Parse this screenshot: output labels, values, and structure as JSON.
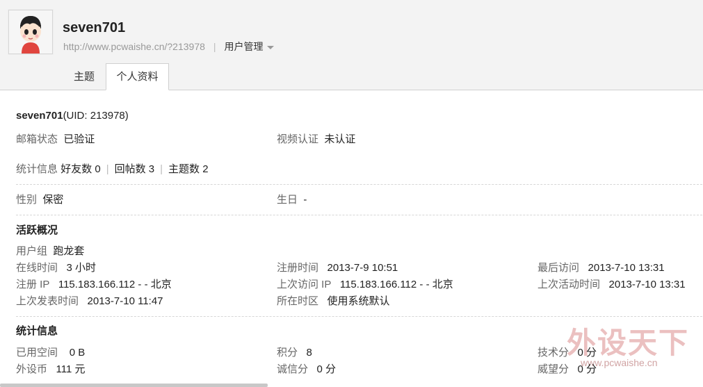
{
  "header": {
    "username": "seven701",
    "url": "http://www.pcwaishe.cn/?213978",
    "separator": "|",
    "user_mgmt": "用户管理"
  },
  "tabs": [
    {
      "label": "主题"
    },
    {
      "label": "个人资料"
    }
  ],
  "profile": {
    "name": "seven701",
    "uid": "(UID: 213978)",
    "email_label": "邮箱状态",
    "email_value": "已验证",
    "video_label": "视频认证",
    "video_value": "未认证",
    "stats_label": "统计信息",
    "friends": "好友数 0",
    "posts": "回帖数 3",
    "threads": "主题数 2",
    "pipe": "|",
    "gender_label": "性别",
    "gender_value": "保密",
    "birthday_label": "生日",
    "birthday_value": "-"
  },
  "activity": {
    "heading": "活跃概况",
    "group_label": "用户组",
    "group_value": "跑龙套",
    "online_label": "在线时间",
    "online_value": "3 小时",
    "reg_time_label": "注册时间",
    "reg_time_value": "2013-7-9 10:51",
    "last_visit_label": "最后访问",
    "last_visit_value": "2013-7-10 13:31",
    "reg_ip_label": "注册 IP",
    "reg_ip_value": "115.183.166.112 - - 北京",
    "last_ip_label": "上次访问 IP",
    "last_ip_value": "115.183.166.112 - - 北京",
    "last_active_label": "上次活动时间",
    "last_active_value": "2013-7-10 13:31",
    "last_post_label": "上次发表时间",
    "last_post_value": "2013-7-10 11:47",
    "tz_label": "所在时区",
    "tz_value": "使用系统默认"
  },
  "statistics": {
    "heading": "统计信息",
    "space_label": "已用空间",
    "space_value": "0 B",
    "points_label": "积分",
    "points_value": "8",
    "tech_label": "技术分",
    "tech_value": "0 分",
    "coins_label": "外设币",
    "coins_value": "111 元",
    "credit_label": "诚信分",
    "credit_value": "0 分",
    "prestige_label": "威望分",
    "prestige_value": "0 分"
  },
  "watermark": {
    "text": "外设天下",
    "url": "www.pcwaishe.cn"
  },
  "colors": {
    "header_bg": "#f3f3f3",
    "watermark": "#e8b6b6"
  }
}
